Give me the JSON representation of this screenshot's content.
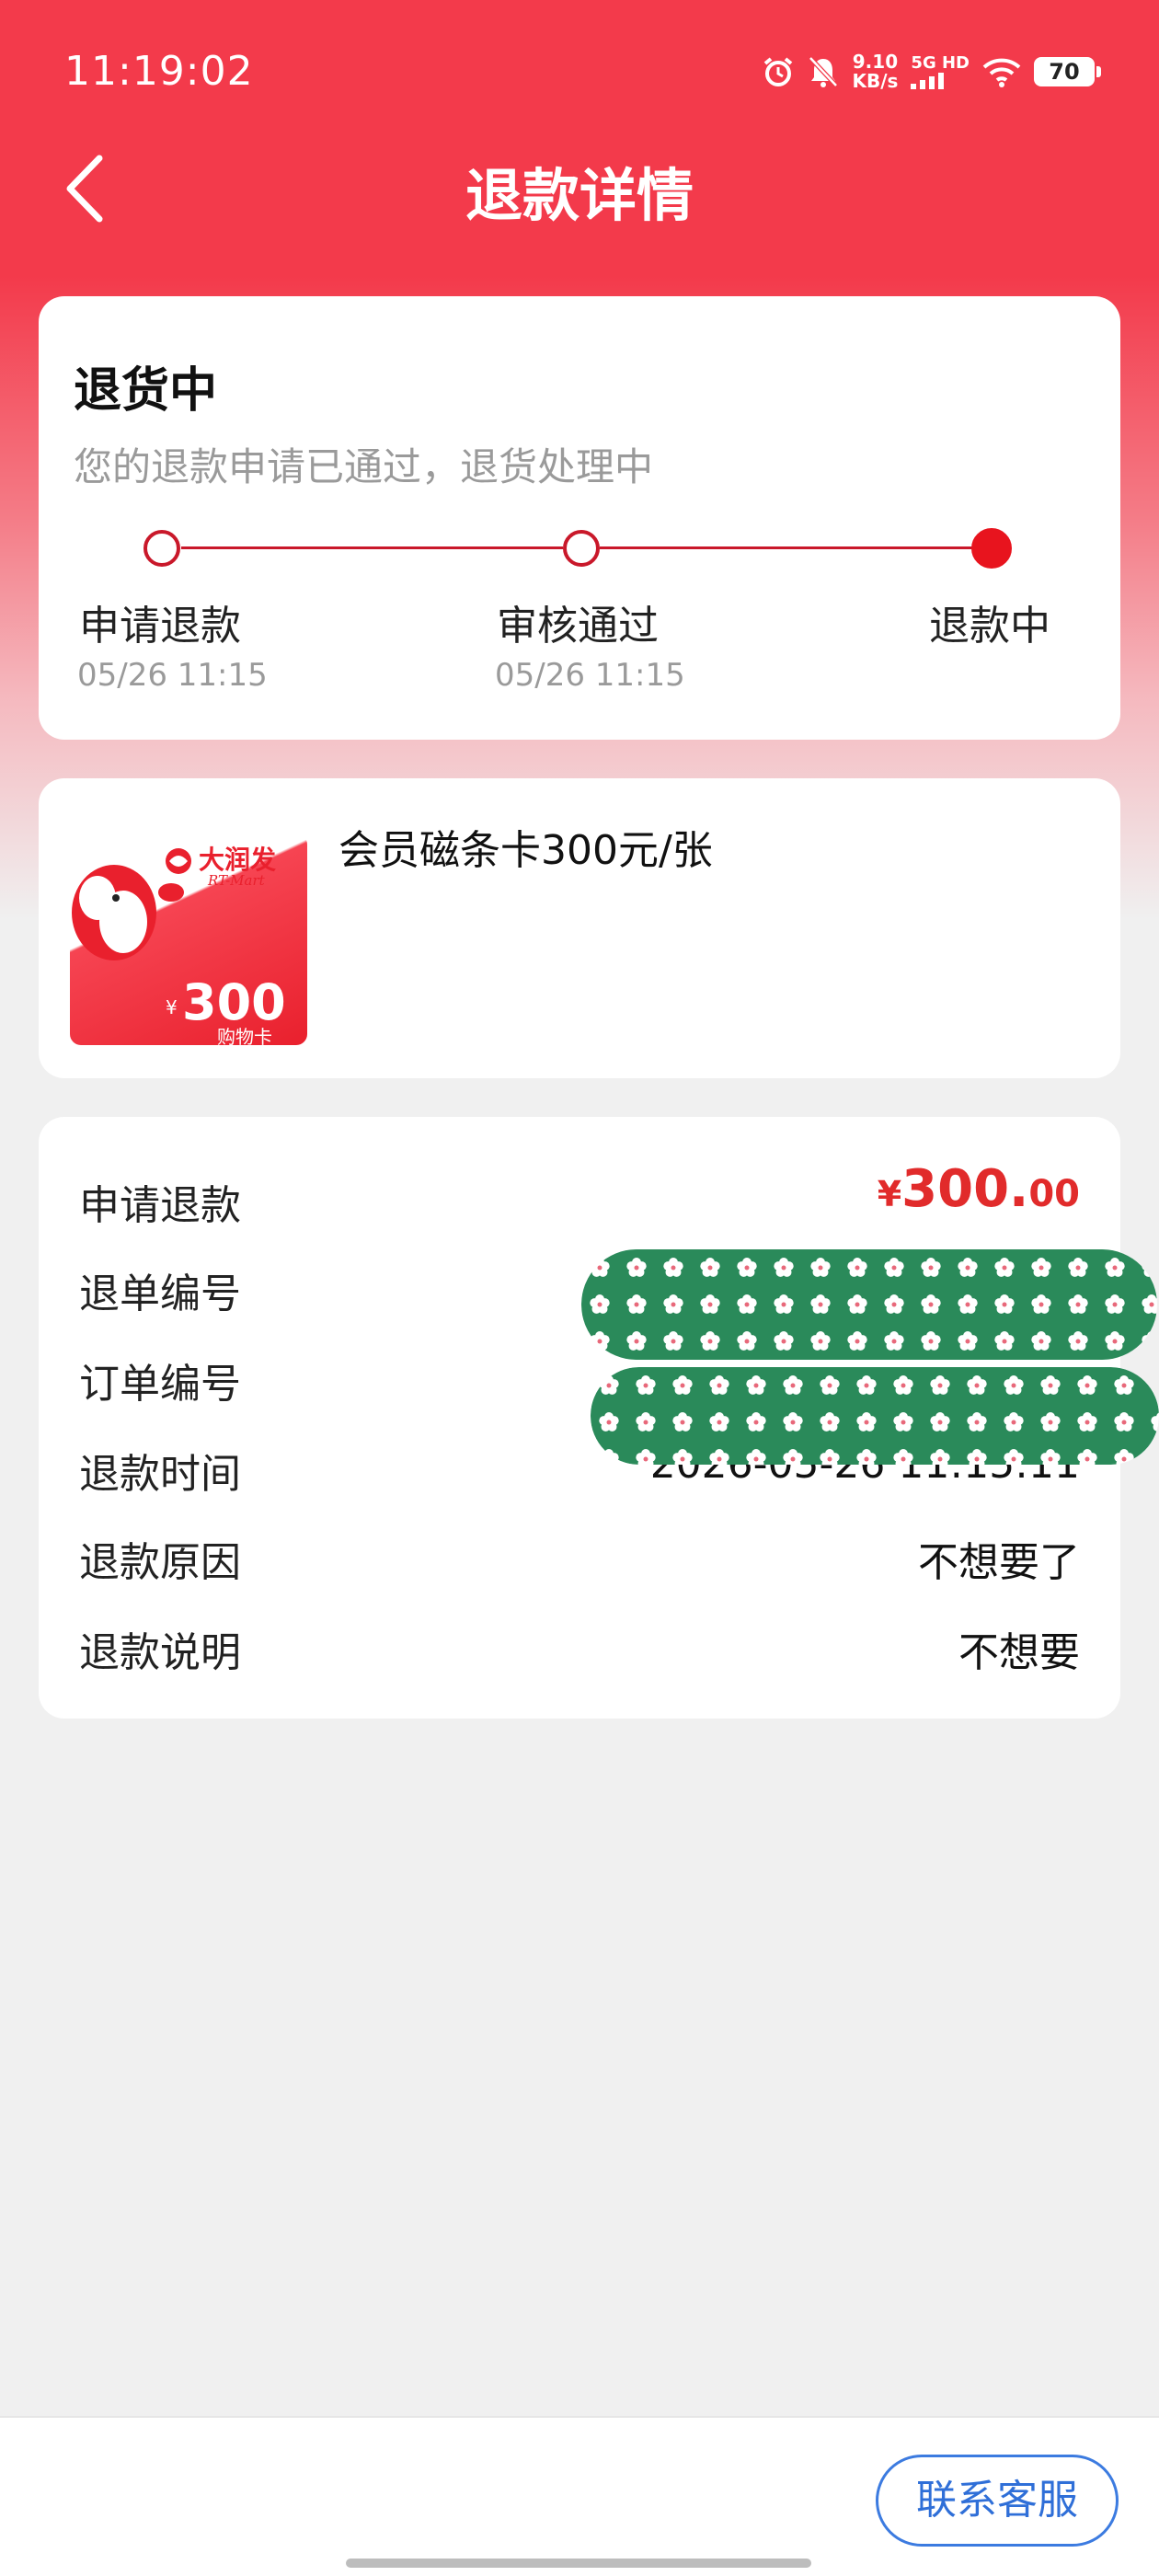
{
  "status_bar": {
    "time": "11:19:02",
    "net_speed_value": "9.10",
    "net_speed_unit": "KB/s",
    "network_type": "5G HD",
    "battery": "70"
  },
  "header": {
    "title": "退款详情",
    "back_icon": "chevron-left-icon"
  },
  "status_card": {
    "title": "退货中",
    "subtitle": "您的退款申请已通过，退货处理中",
    "steps": [
      {
        "label": "申请退款",
        "time": "05/26 11:15"
      },
      {
        "label": "审核通过",
        "time": "05/26 11:15"
      },
      {
        "label": "退款中",
        "time": ""
      }
    ],
    "active_step": 3
  },
  "product": {
    "name": "会员磁条卡300元/张",
    "image": {
      "brand_cn": "大润发",
      "brand_en": "RT-Mart",
      "currency": "¥",
      "value": "300",
      "caption": "购物卡"
    }
  },
  "details": {
    "rows": [
      {
        "label": "申请退款",
        "currency": "¥",
        "int": "300.",
        "dec": "00"
      },
      {
        "label": "退单编号",
        "value": ""
      },
      {
        "label": "订单编号",
        "value": ""
      },
      {
        "label": "退款时间",
        "value": "2026-05-26 11:15:11"
      },
      {
        "label": "退款原因",
        "value": "不想要了"
      },
      {
        "label": "退款说明",
        "value": "不想要"
      }
    ]
  },
  "footer": {
    "contact_label": "联系客服"
  },
  "colors": {
    "header_red": "#f33a4b",
    "progress_red": "#c9182a",
    "amount_red": "#e12b2b",
    "button_blue": "#2f6fd8",
    "redaction_green": "#2a8a5a"
  }
}
